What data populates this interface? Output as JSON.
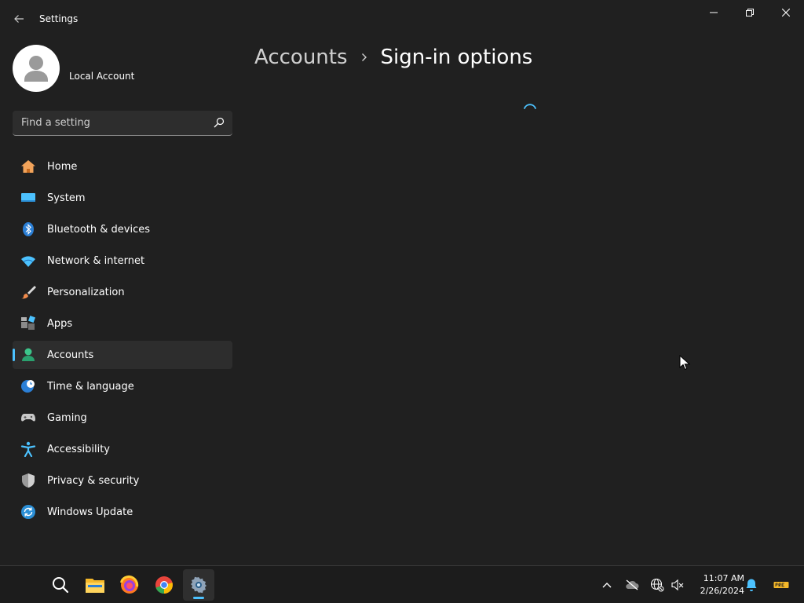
{
  "window": {
    "title": "Settings",
    "controls": [
      "minimize",
      "restore",
      "close"
    ]
  },
  "profile": {
    "name": "Local Account"
  },
  "search": {
    "placeholder": "Find a setting"
  },
  "nav": {
    "items": [
      {
        "label": "Home",
        "icon": "home-icon"
      },
      {
        "label": "System",
        "icon": "system-icon"
      },
      {
        "label": "Bluetooth & devices",
        "icon": "bluetooth-icon"
      },
      {
        "label": "Network & internet",
        "icon": "wifi-icon"
      },
      {
        "label": "Personalization",
        "icon": "brush-icon"
      },
      {
        "label": "Apps",
        "icon": "apps-icon"
      },
      {
        "label": "Accounts",
        "icon": "accounts-icon",
        "active": true
      },
      {
        "label": "Time & language",
        "icon": "globe-clock-icon"
      },
      {
        "label": "Gaming",
        "icon": "gamepad-icon"
      },
      {
        "label": "Accessibility",
        "icon": "accessibility-icon"
      },
      {
        "label": "Privacy & security",
        "icon": "shield-icon"
      },
      {
        "label": "Windows Update",
        "icon": "update-icon"
      }
    ]
  },
  "breadcrumb": {
    "parent": "Accounts",
    "current": "Sign-in options"
  },
  "taskbar": {
    "apps": [
      "search-icon",
      "file-explorer-icon",
      "firefox-icon",
      "chrome-icon",
      "settings-icon"
    ],
    "active_app": "settings-icon",
    "time": "11:07 AM",
    "date": "2/26/2024"
  },
  "colors": {
    "accent": "#4cc2ff",
    "background": "#202020",
    "taskbar": "#1c1c1c"
  }
}
